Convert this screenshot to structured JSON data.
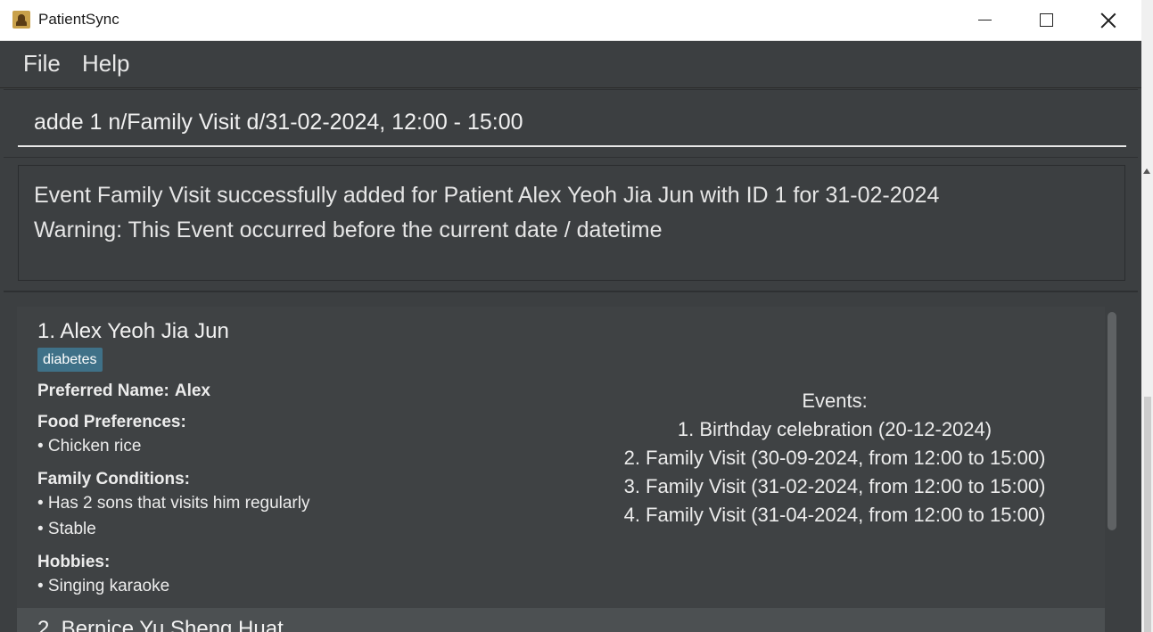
{
  "window": {
    "title": "PatientSync"
  },
  "menu": {
    "file": "File",
    "help": "Help"
  },
  "command": {
    "value": "adde 1 n/Family Visit d/31-02-2024, 12:00 - 15:00"
  },
  "result": {
    "line1": "Event Family Visit successfully added for Patient Alex Yeoh Jia Jun with ID 1 for 31-02-2024",
    "line2": "Warning: This Event occurred before the current date / datetime"
  },
  "patients": [
    {
      "index_name": "1.  Alex Yeoh Jia Jun",
      "tag": "diabetes",
      "preferred_label": "Preferred Name:",
      "preferred_value": "Alex",
      "food_label": "Food Preferences:",
      "food_items": [
        "• Chicken rice"
      ],
      "family_label": "Family Conditions:",
      "family_items": [
        "• Has 2 sons that visits him regularly",
        "• Stable"
      ],
      "hobbies_label": "Hobbies:",
      "hobbies_items": [
        "• Singing karaoke"
      ],
      "events_label": "Events:",
      "events": [
        "1. Birthday celebration (20-12-2024)",
        "2. Family Visit (30-09-2024, from 12:00 to 15:00)",
        "3. Family Visit (31-02-2024, from 12:00 to 15:00)",
        "4. Family Visit (31-04-2024, from 12:00 to 15:00)"
      ]
    },
    {
      "index_name": "2.  Bernice Yu Sheng Huat"
    }
  ]
}
